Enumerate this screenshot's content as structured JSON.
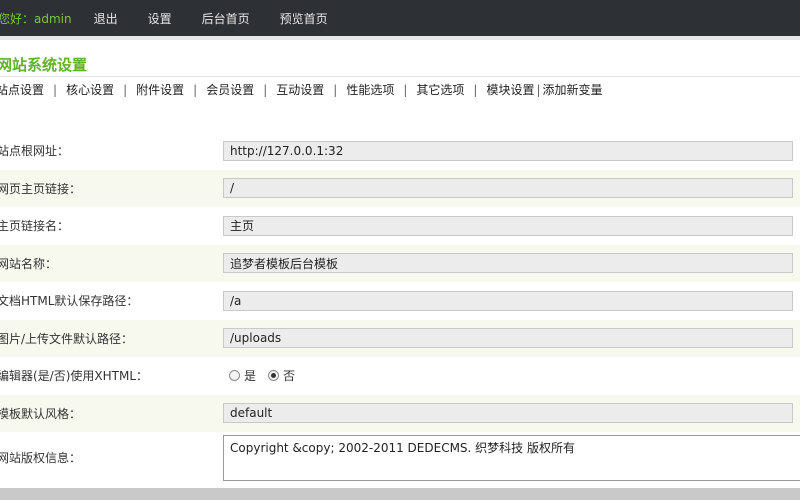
{
  "topbar": {
    "greeting_prefix": "您好：",
    "username": "admin",
    "links": [
      "退出",
      "设置",
      "后台首页",
      "预览首页"
    ]
  },
  "page": {
    "title": "网站系统设置"
  },
  "tabs": [
    "站点设置",
    "核心设置",
    "附件设置",
    "会员设置",
    "互动设置",
    "性能选项",
    "其它选项",
    "模块设置",
    "添加新变量"
  ],
  "form": {
    "rows": [
      {
        "label": "站点根网址：",
        "value": "http://127.0.0.1:32"
      },
      {
        "label": "网页主页链接：",
        "value": "/"
      },
      {
        "label": "主页链接名：",
        "value": "主页"
      },
      {
        "label": "网站名称：",
        "value": "追梦者模板后台模板"
      },
      {
        "label": "文档HTML默认保存路径：",
        "value": "/a"
      },
      {
        "label": "图片/上传文件默认路径：",
        "value": "/uploads"
      }
    ],
    "xhtml": {
      "label": "编辑器(是/否)使用XHTML：",
      "option_yes": "是",
      "option_no": "否",
      "selected": "否"
    },
    "style": {
      "label": "模板默认风格：",
      "value": "default"
    },
    "copyright": {
      "label": "网站版权信息：",
      "value": "Copyright &copy; 2002-2011 DEDECMS. 织梦科技 版权所有"
    }
  },
  "colors": {
    "topbar_bg": "#2d3035",
    "accent_green": "#62b12a",
    "row_alt_bg": "#f7f9ef"
  }
}
